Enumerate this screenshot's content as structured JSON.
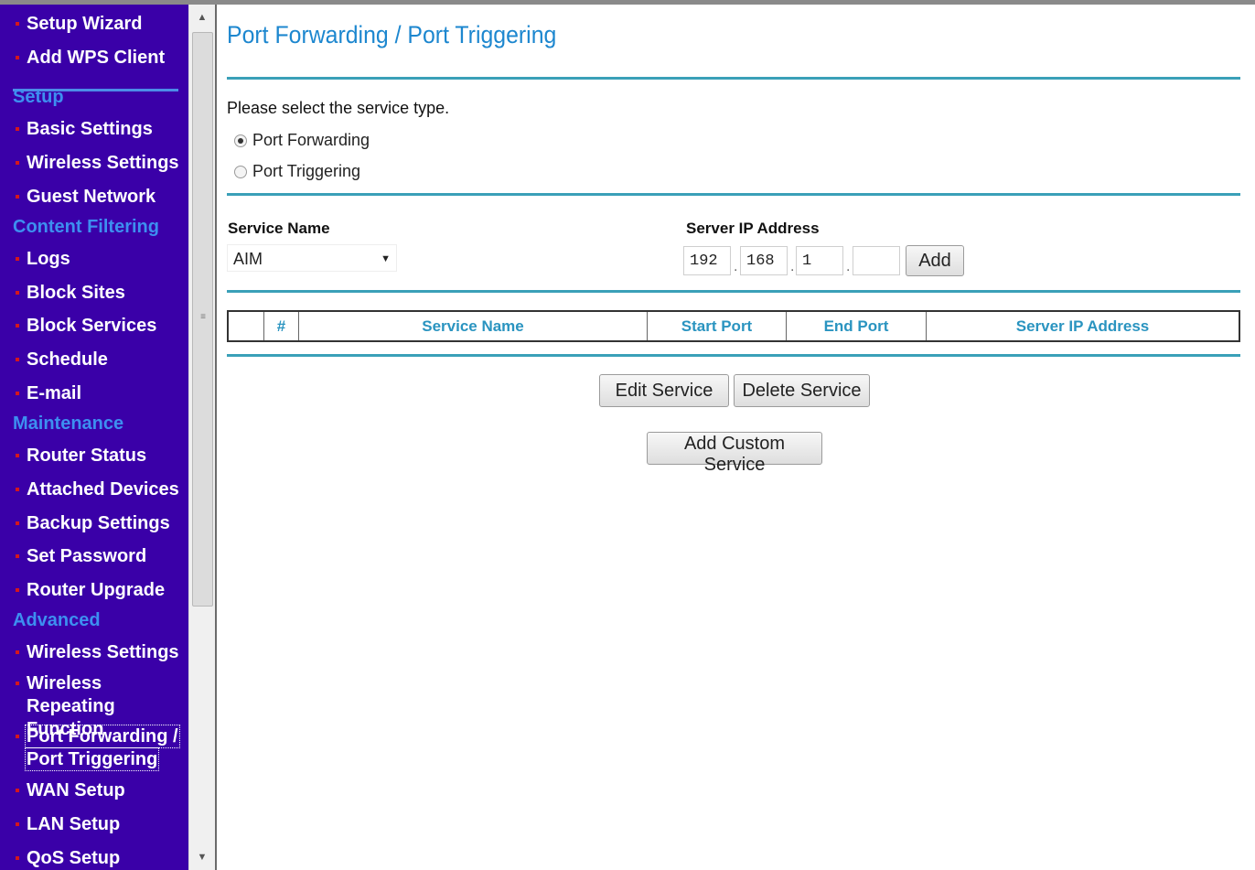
{
  "sidebar": {
    "items": [
      {
        "type": "item",
        "label": "Setup Wizard"
      },
      {
        "type": "item",
        "label": "Add WPS Client"
      },
      {
        "type": "section",
        "label": "Setup"
      },
      {
        "type": "item",
        "label": "Basic Settings"
      },
      {
        "type": "item",
        "label": "Wireless Settings"
      },
      {
        "type": "item",
        "label": "Guest Network"
      },
      {
        "type": "section",
        "label": "Content Filtering"
      },
      {
        "type": "item",
        "label": "Logs"
      },
      {
        "type": "item",
        "label": "Block Sites"
      },
      {
        "type": "item",
        "label": "Block Services"
      },
      {
        "type": "item",
        "label": "Schedule"
      },
      {
        "type": "item",
        "label": "E-mail"
      },
      {
        "type": "section",
        "label": "Maintenance"
      },
      {
        "type": "item",
        "label": "Router Status"
      },
      {
        "type": "item",
        "label": "Attached Devices"
      },
      {
        "type": "item",
        "label": "Backup Settings"
      },
      {
        "type": "item",
        "label": "Set Password"
      },
      {
        "type": "item",
        "label": "Router Upgrade"
      },
      {
        "type": "section",
        "label": "Advanced"
      },
      {
        "type": "item",
        "label": "Wireless Settings"
      },
      {
        "type": "item",
        "label": "Wireless Repeating",
        "label2": "Function"
      },
      {
        "type": "item",
        "label": "Port Forwarding /",
        "label2": "Port Triggering",
        "active": true
      },
      {
        "type": "item",
        "label": "WAN Setup"
      },
      {
        "type": "item",
        "label": "LAN Setup"
      },
      {
        "type": "item",
        "label": "QoS Setup"
      }
    ]
  },
  "page": {
    "title": "Port Forwarding / Port Triggering",
    "prompt": "Please select the service type.",
    "radio_forwarding": "Port Forwarding",
    "radio_triggering": "Port Triggering",
    "service_name_label": "Service Name",
    "service_name_value": "AIM",
    "server_ip_label": "Server IP Address",
    "ip": [
      "192",
      "168",
      "1",
      ""
    ],
    "add_button": "Add",
    "table_headers": [
      "",
      "#",
      "Service Name",
      "Start Port",
      "End Port",
      "Server IP Address"
    ],
    "edit_button": "Edit Service",
    "delete_button": "Delete Service",
    "add_custom_button": "Add Custom Service"
  },
  "colors": {
    "sidebar_bg": "#3a00a8",
    "section_text": "#3d8ff0",
    "title_text": "#1d87cf",
    "rule": "#3aa0b8",
    "bullet": "#d4171d"
  }
}
